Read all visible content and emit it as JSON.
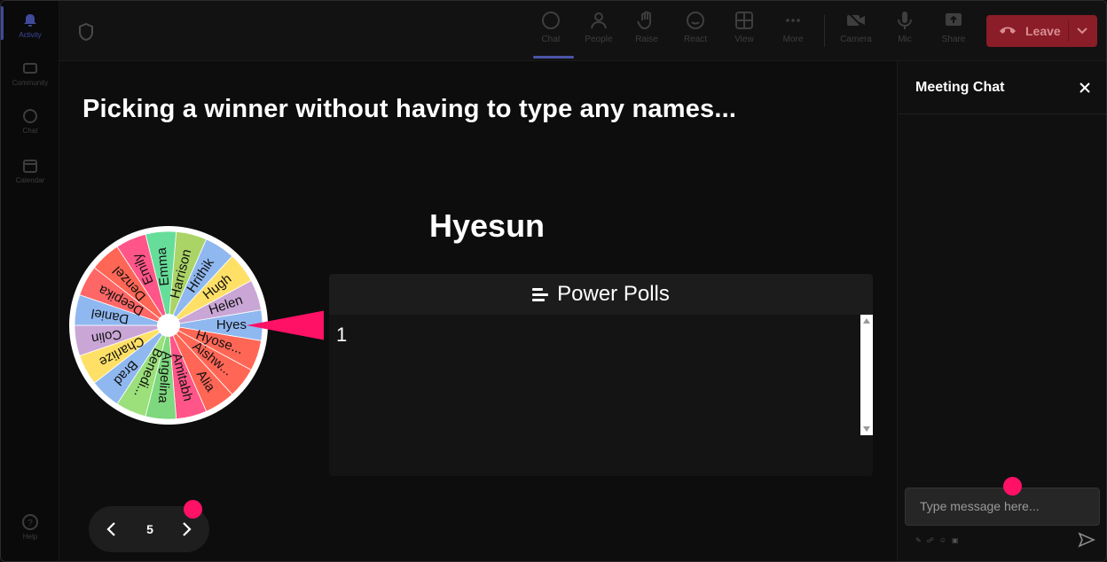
{
  "rail": {
    "items": [
      {
        "label": "Activity",
        "icon": "bell-icon"
      },
      {
        "label": "Community",
        "icon": "community-icon"
      },
      {
        "label": "Chat",
        "icon": "chat-icon"
      },
      {
        "label": "Calendar",
        "icon": "calendar-icon"
      },
      {
        "label": "Help",
        "icon": "help-icon"
      }
    ]
  },
  "toolbar": {
    "chat": "Chat",
    "people": "People",
    "raise": "Raise",
    "react": "React",
    "view": "View",
    "more": "More",
    "camera": "Camera",
    "mic": "Mic",
    "share": "Share",
    "leave": "Leave"
  },
  "stage": {
    "heading": "Picking a winner without having to type any names...",
    "winner": "Hyesun",
    "wheel": {
      "names": [
        "Hyes",
        "Hyose...",
        "Aishw...",
        "Alia",
        "Amitabh",
        "Angelina",
        "Benedi...",
        "Brad",
        "Charlize",
        "Colin",
        "Daniel",
        "Deepika",
        "Denzel",
        "Emily",
        "Emma",
        "Harrison",
        "Hrithik",
        "Hugh",
        "Helen"
      ],
      "colors": [
        "#8fb8f0",
        "#ff6655",
        "#ff6655",
        "#ff6655",
        "#ff5588",
        "#7ed87e",
        "#9be07a",
        "#8fb8f0",
        "#ffe066",
        "#c9a6d6",
        "#8fb8f0",
        "#ff6666",
        "#ff6655",
        "#ff5588",
        "#66dd99",
        "#aad466",
        "#8fb8f0",
        "#ffe066",
        "#c9a6d6"
      ]
    },
    "polls": {
      "title": "Power Polls",
      "value": "1"
    },
    "pager": {
      "page": "5"
    }
  },
  "chat": {
    "title": "Meeting Chat",
    "placeholder": "Type message here..."
  },
  "colors": {
    "accent": "#4b56a8",
    "leave": "#8a1d27",
    "marker": "#ff1166"
  }
}
